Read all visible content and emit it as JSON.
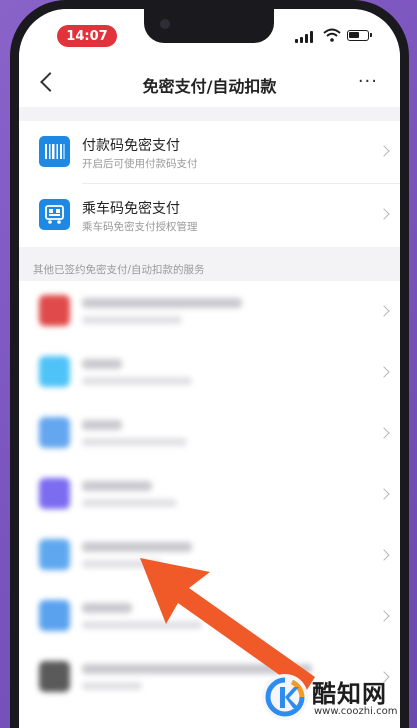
{
  "status_bar": {
    "time": "14:07"
  },
  "nav": {
    "title": "免密支付/自动扣款",
    "back_label": "<",
    "more_label": "···"
  },
  "top_items": [
    {
      "title": "付款码免密支付",
      "subtitle": "开启后可使用付款码支付",
      "icon": "barcode-icon",
      "color": "#1e88e5"
    },
    {
      "title": "乘车码免密支付",
      "subtitle": "乘车码免密支付授权管理",
      "icon": "bus-qr-icon",
      "color": "#1e88e5"
    }
  ],
  "section_label": "其他已签约免密支付/自动扣款的服务",
  "services": [
    {
      "icon": "red",
      "color": "#e04a4a"
    },
    {
      "icon": "cyan",
      "color": "#4fc3f7"
    },
    {
      "icon": "blue",
      "color": "#64a6ef"
    },
    {
      "icon": "purple",
      "color": "#7b6cf0"
    },
    {
      "icon": "blue",
      "color": "#5fa8ef"
    },
    {
      "icon": "blue",
      "color": "#5aa2ee"
    },
    {
      "icon": "gray",
      "color": "#5a5a5a"
    }
  ],
  "watermark": {
    "title": "酷知网",
    "url": "www.coozhi.com"
  },
  "colors": {
    "accent": "#1e88e5",
    "arrow": "#f05a28",
    "time_pill": "#e2333c"
  }
}
